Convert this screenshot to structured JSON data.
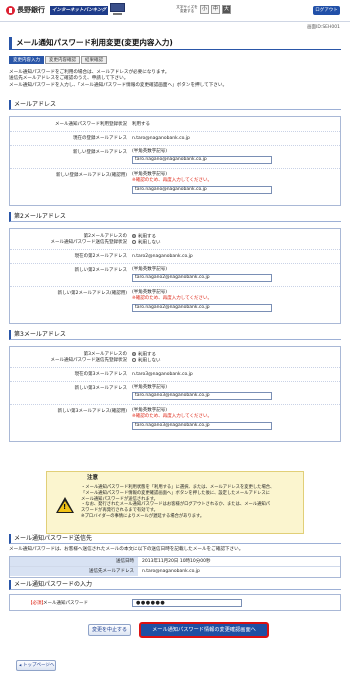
{
  "header": {
    "bank_name": "長野銀行",
    "service_badge": "インターネットバンキング",
    "font_size_label": "文字サイズを変更する",
    "font_sizes": [
      "小",
      "中",
      "大"
    ],
    "font_size_selected": "大",
    "logout_label": "ログアウト"
  },
  "screen_id": "画面ID:SEH001",
  "page_title": "メール通知パスワード利用変更(変更内容入力)",
  "steps": [
    "変更内容入力",
    "変更内容確認",
    "結果確認"
  ],
  "active_step": "変更内容入力",
  "intro": [
    "メール通知パスワードをご利用の場合は、メールアドレスが必要になります。",
    "送信先メールアドレスをご確認のうえ、申請して下さい。",
    "メール通知パスワードを入力し、「メール通知パスワード情報の変更確認画面へ」ボタンを押して下さい。"
  ],
  "section1": {
    "heading": "メールアドレス",
    "status_label": "メール通知パスワード利用登録状況",
    "status_value": "利用する",
    "current_label": "現在の登録メールアドレス",
    "current_value": "n.taro@naganobank.co.jp",
    "new_label": "新しい登録メールアドレス",
    "new_hint": "(半角英数字記号)",
    "new_value": "taro.nagano@naganobank.co.jp",
    "confirm_label": "新しい登録メールアドレス(確認用)",
    "confirm_hint": "(半角英数字記号)",
    "confirm_warn": "※確認のため、再度入力してください。",
    "confirm_value": "taro.nagano@naganobank.co.jp"
  },
  "section2": {
    "heading": "第2メールアドレス",
    "status_label_1": "第2メールアドレスの",
    "status_label_2": "メール通知パスワード送信先登録状況",
    "opt_use": "利用する",
    "opt_nouse": "利用しない",
    "current_label": "現在の第2メールアドレス",
    "current_value": "n.taro2@naganobank.co.jp",
    "new_label": "新しい第2メールアドレス",
    "new_hint": "(半角英数字記号)",
    "new_value": "taro.nagano2@naganobank.co.jp",
    "confirm_label": "新しい第2メールアドレス(確認用)",
    "confirm_hint": "(半角英数字記号)",
    "confirm_warn": "※確認のため、再度入力してください。",
    "confirm_value": "taro.nagano2@naganobank.co.jp"
  },
  "section3": {
    "heading": "第3メールアドレス",
    "status_label_1": "第3メールアドレスの",
    "status_label_2": "メール通知パスワード送信先登録状況",
    "opt_use": "利用する",
    "opt_nouse": "利用しない",
    "current_label": "現在の第3メールアドレス",
    "current_value": "n.taro3@naganobank.co.jp",
    "new_label": "新しい第3メールアドレス",
    "new_hint": "(半角英数字記号)",
    "new_value": "taro.nagano3@naganobank.co.jp",
    "confirm_label": "新しい第3メールアドレス(確認用)",
    "confirm_hint": "(半角英数字記号)",
    "confirm_warn": "※確認のため、再度入力してください。",
    "confirm_value": "taro.nagano3@naganobank.co.jp"
  },
  "notice": {
    "title": "注意",
    "lines": [
      "・メール通知パスワード利用状態を「利用する」に選択、または、メールアドレスを変更した場合、",
      "「メール通知パスワード情報の変更確認画面へ」ボタンを押した後に、設定したメールアドレスに",
      "メール通知パスワードが送信されます。",
      "・なお、発行されたメール通知パスワードはお客様がログアウトされるか、または、メール通知パ",
      "スワードが再発行されるまで有効です。",
      "※プロバイダーの事情によりメールが遅延する場合があります。"
    ]
  },
  "send": {
    "heading": "メール通知パスワード送信先",
    "desc": "メール通知パスワードは、お客様へ送信されたメールの本文に以下の送信日時を記載したメールをご確認下さい。",
    "time_label": "送信日時",
    "time_value": "2013年11月20日 10時10分00秒",
    "addr_label": "送信先メールアドレス",
    "addr_value": "n.taro@naganobank.co.jp"
  },
  "password": {
    "heading": "メール通知パスワードの入力",
    "required": "【必須】",
    "label": "メール通知パスワード",
    "value": "●●●●●●"
  },
  "buttons": {
    "cancel": "変更を中止する",
    "next": "メール通知パスワード情報の変更確認画面へ",
    "top": "トップページへ"
  }
}
